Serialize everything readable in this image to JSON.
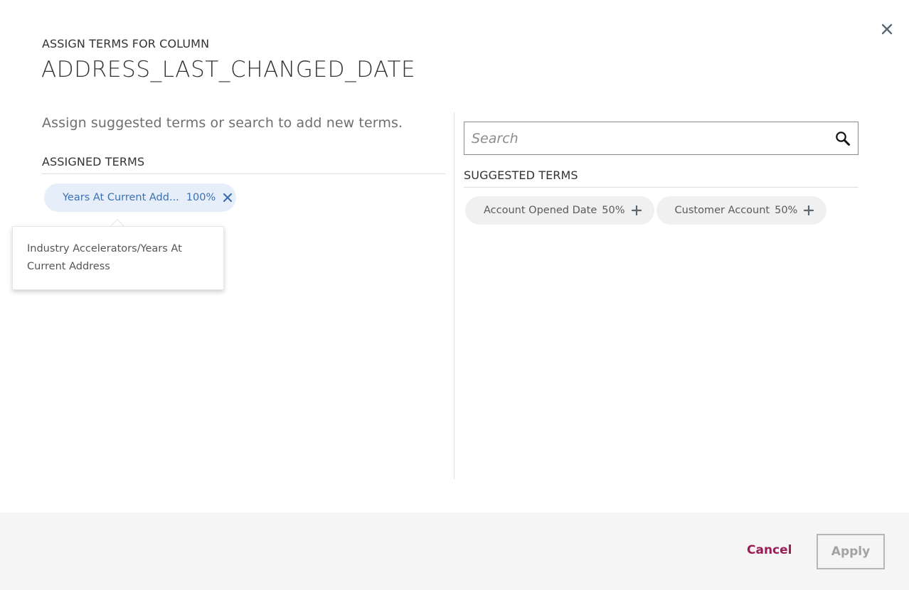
{
  "dialog": {
    "eyebrow": "ASSIGN TERMS FOR COLUMN",
    "title": "ADDRESS_LAST_CHANGED_DATE",
    "close_icon": "close-icon"
  },
  "left": {
    "instructions": "Assign suggested terms or search to add new terms.",
    "assigned_heading": "ASSIGNED TERMS",
    "assigned_terms": [
      {
        "label": "Years At Current Add...",
        "confidence": "100%",
        "remove_icon": "close-icon",
        "tooltip": "Industry Accelerators/Years At Current Address"
      }
    ]
  },
  "right": {
    "search": {
      "placeholder": "Search",
      "value": "",
      "icon": "search-icon"
    },
    "suggested_heading": "SUGGESTED TERMS",
    "suggested_terms": [
      {
        "label": "Account Opened Date",
        "confidence": "50%",
        "add_icon": "plus-icon"
      },
      {
        "label": "Customer Account",
        "confidence": "50%",
        "add_icon": "plus-icon"
      }
    ]
  },
  "footer": {
    "cancel_label": "Cancel",
    "apply_label": "Apply",
    "apply_enabled": false
  },
  "colors": {
    "accent_link": "#9b1d56",
    "assigned_chip_bg": "#e5eef9",
    "assigned_chip_text": "#3d70b2",
    "suggested_chip_bg": "#f0f0f0",
    "footer_bg": "#f5f5f5"
  }
}
